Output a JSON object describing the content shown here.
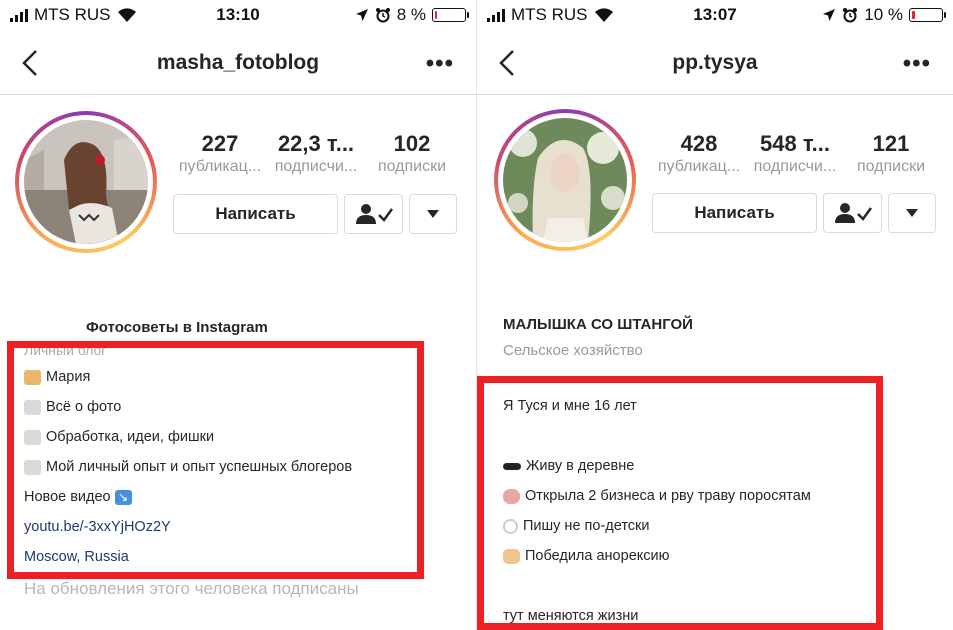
{
  "left": {
    "status": {
      "carrier": "MTS RUS",
      "time": "13:10",
      "battery": "8 %",
      "battery_level": 0.08
    },
    "username": "masha_fotoblog",
    "more": "•••",
    "stats": [
      {
        "value": "227",
        "label": "публикац..."
      },
      {
        "value": "22,3 т...",
        "label": "подписчи..."
      },
      {
        "value": "102",
        "label": "подписки"
      }
    ],
    "message_button": "Написать",
    "bio": {
      "title": "Фотосоветы в Instagram",
      "category": "Личный блог",
      "lines": [
        {
          "text": "Мария",
          "emoji": "person-gesturing-icon"
        },
        {
          "text": "Всё о фото",
          "emoji": "photo-icon"
        },
        {
          "text": "Обработка, идеи, фишки",
          "emoji": "photo-icon"
        },
        {
          "text": "Мой личный опыт и опыт успешных блогеров",
          "emoji": "photo-icon"
        },
        {
          "text": "Новое видео",
          "emoji": "arrow-down-right-icon"
        }
      ],
      "link": "youtu.be/-3xxYjHOz2Y",
      "location": "Moscow, Russia",
      "followed_note": "На обновления этого человека подписаны"
    }
  },
  "right": {
    "status": {
      "carrier": "MTS RUS",
      "time": "13:07",
      "battery": "10 %",
      "battery_level": 0.1
    },
    "username": "pp.tysya",
    "more": "•••",
    "stats": [
      {
        "value": "428",
        "label": "публикац..."
      },
      {
        "value": "548 т...",
        "label": "подписчи..."
      },
      {
        "value": "121",
        "label": "подписки"
      }
    ],
    "message_button": "Написать",
    "bio": {
      "title": "МАЛЫШКА СО ШТАНГОЙ",
      "category": "Сельское хозяйство",
      "lines": [
        {
          "text": "Я Туся и мне 16 лет",
          "emoji": ""
        },
        {
          "text": "Живу в деревне",
          "emoji": "sunglasses-icon"
        },
        {
          "text": "Открыла 2 бизнеса и рву траву поросятам",
          "emoji": "pig-icon"
        },
        {
          "text": "Пишу не по-детски",
          "emoji": "ring-icon"
        },
        {
          "text": "Победила анорексию",
          "emoji": "fist-icon"
        },
        {
          "text": "тут меняются жизни",
          "emoji": ""
        }
      ]
    }
  },
  "colors": {
    "highlight": "#ee1f25",
    "link": "#1d3b6e",
    "muted": "#999999"
  }
}
